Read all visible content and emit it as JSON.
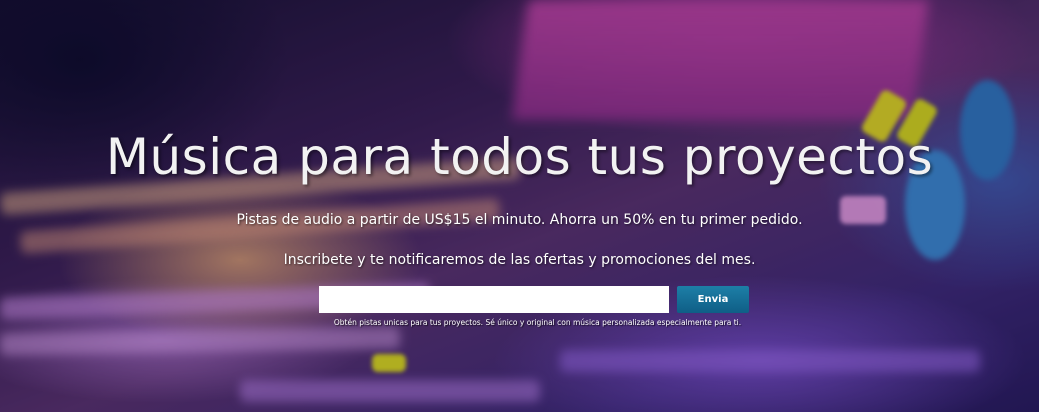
{
  "hero": {
    "headline": "Música para todos tus proyectos",
    "subtitle": "Pistas de audio a partir de US$15 el minuto. Ahorra un 50% en tu primer pedido.",
    "cta_text": "Inscribete y te notificaremos de las ofertas y promociones del mes."
  },
  "signup": {
    "email_value": "",
    "email_placeholder": "",
    "send_label": "Envia",
    "disclaimer": "Obtén pistas unicas para tus proyectos. Sé único y original con música personalizada especialmente para ti."
  },
  "colors": {
    "button": "#1d7fa7",
    "headline": "#f2f2f2"
  }
}
